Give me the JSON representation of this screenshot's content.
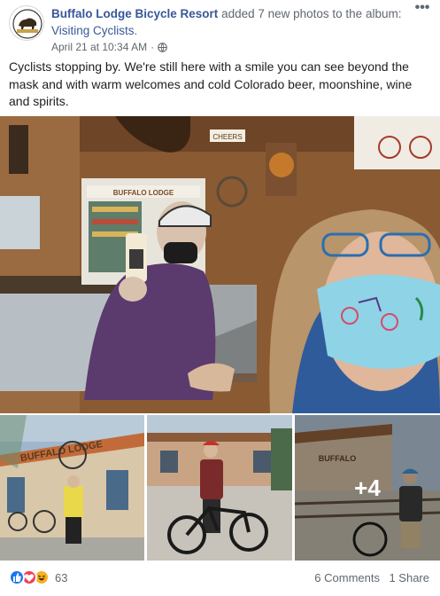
{
  "post": {
    "page_name": "Buffalo Lodge Bicycle Resort",
    "action_text": "added 7 new photos to the album:",
    "album_name": "Visiting Cyclists",
    "album_suffix": ".",
    "timestamp": "April 21 at 10:34 AM",
    "separator": "·",
    "more_label": "•••",
    "body": "Cyclists stopping by. We're still here with a smile you can see beyond the mask and with warm welcomes and cold Colorado beer, moonshine, wine and spirits."
  },
  "photos": {
    "main_sign_text": "CHEERS",
    "bar_sign_text": "BUFFALO LODGE",
    "thumb1_sign_text": "BUFFALO LODGE",
    "thumb3_sign_text": "BUFFALO",
    "more_count": "+4"
  },
  "footer": {
    "reaction_count": "63",
    "comments": "6 Comments",
    "shares": "1 Share"
  },
  "colors": {
    "link": "#385898",
    "secondary_text": "#606770",
    "like": "#1877f2",
    "love": "#f33e58",
    "haha": "#f7b125"
  }
}
